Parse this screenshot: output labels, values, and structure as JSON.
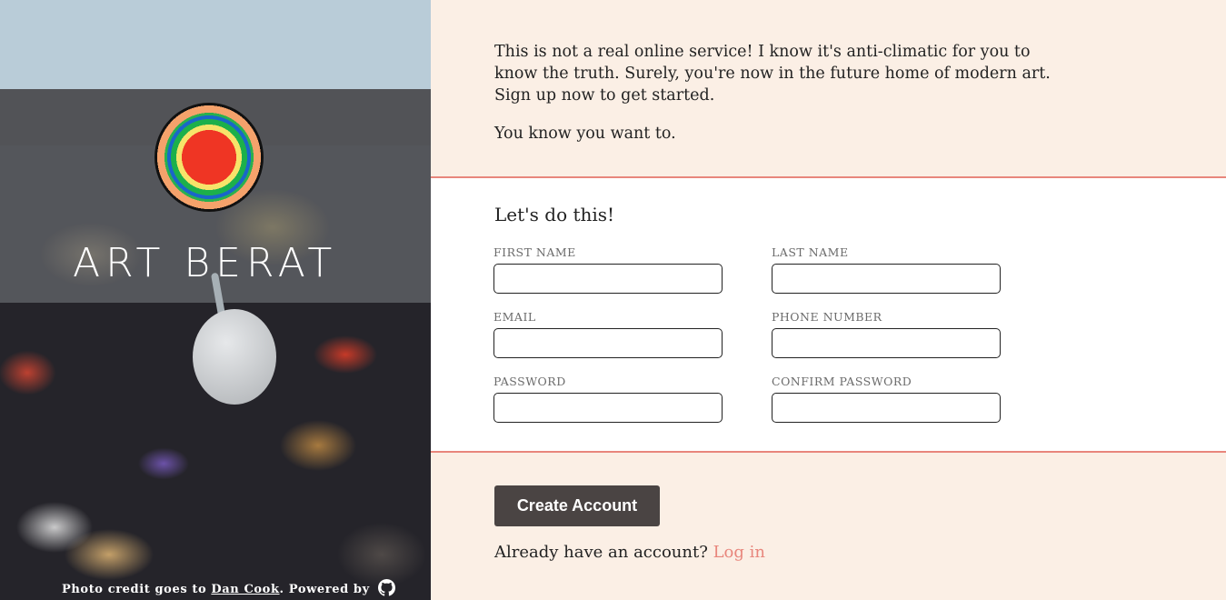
{
  "hero": {
    "brand": "ART BERAT",
    "logo_icon": "concentric-rings-logo",
    "credit_prefix": "Photo credit goes to ",
    "credit_author": "Dan Cook",
    "credit_middle": ". Powered by ",
    "powered_icon": "github-icon"
  },
  "intro": {
    "paragraph1": "This is not a real online service! I know it's anti-climatic for you to\nknow the truth. Surely, you're now in the future home of modern art.\nSign up now to get started.",
    "paragraph2": "You know you want to."
  },
  "form": {
    "heading": "Let's do this!",
    "fields": {
      "first_name": {
        "label": "First Name",
        "value": ""
      },
      "last_name": {
        "label": "Last Name",
        "value": ""
      },
      "email": {
        "label": "Email",
        "value": ""
      },
      "phone": {
        "label": "Phone Number",
        "value": ""
      },
      "password": {
        "label": "Password",
        "value": ""
      },
      "confirm_password": {
        "label": "Confirm Password",
        "value": ""
      }
    }
  },
  "footer": {
    "create_button": "Create Account",
    "login_prompt": "Already have an account? ",
    "login_link": "Log in"
  },
  "colors": {
    "accent": "#e8867c",
    "button_bg": "#4a4443",
    "page_bg": "#fbefe5"
  }
}
